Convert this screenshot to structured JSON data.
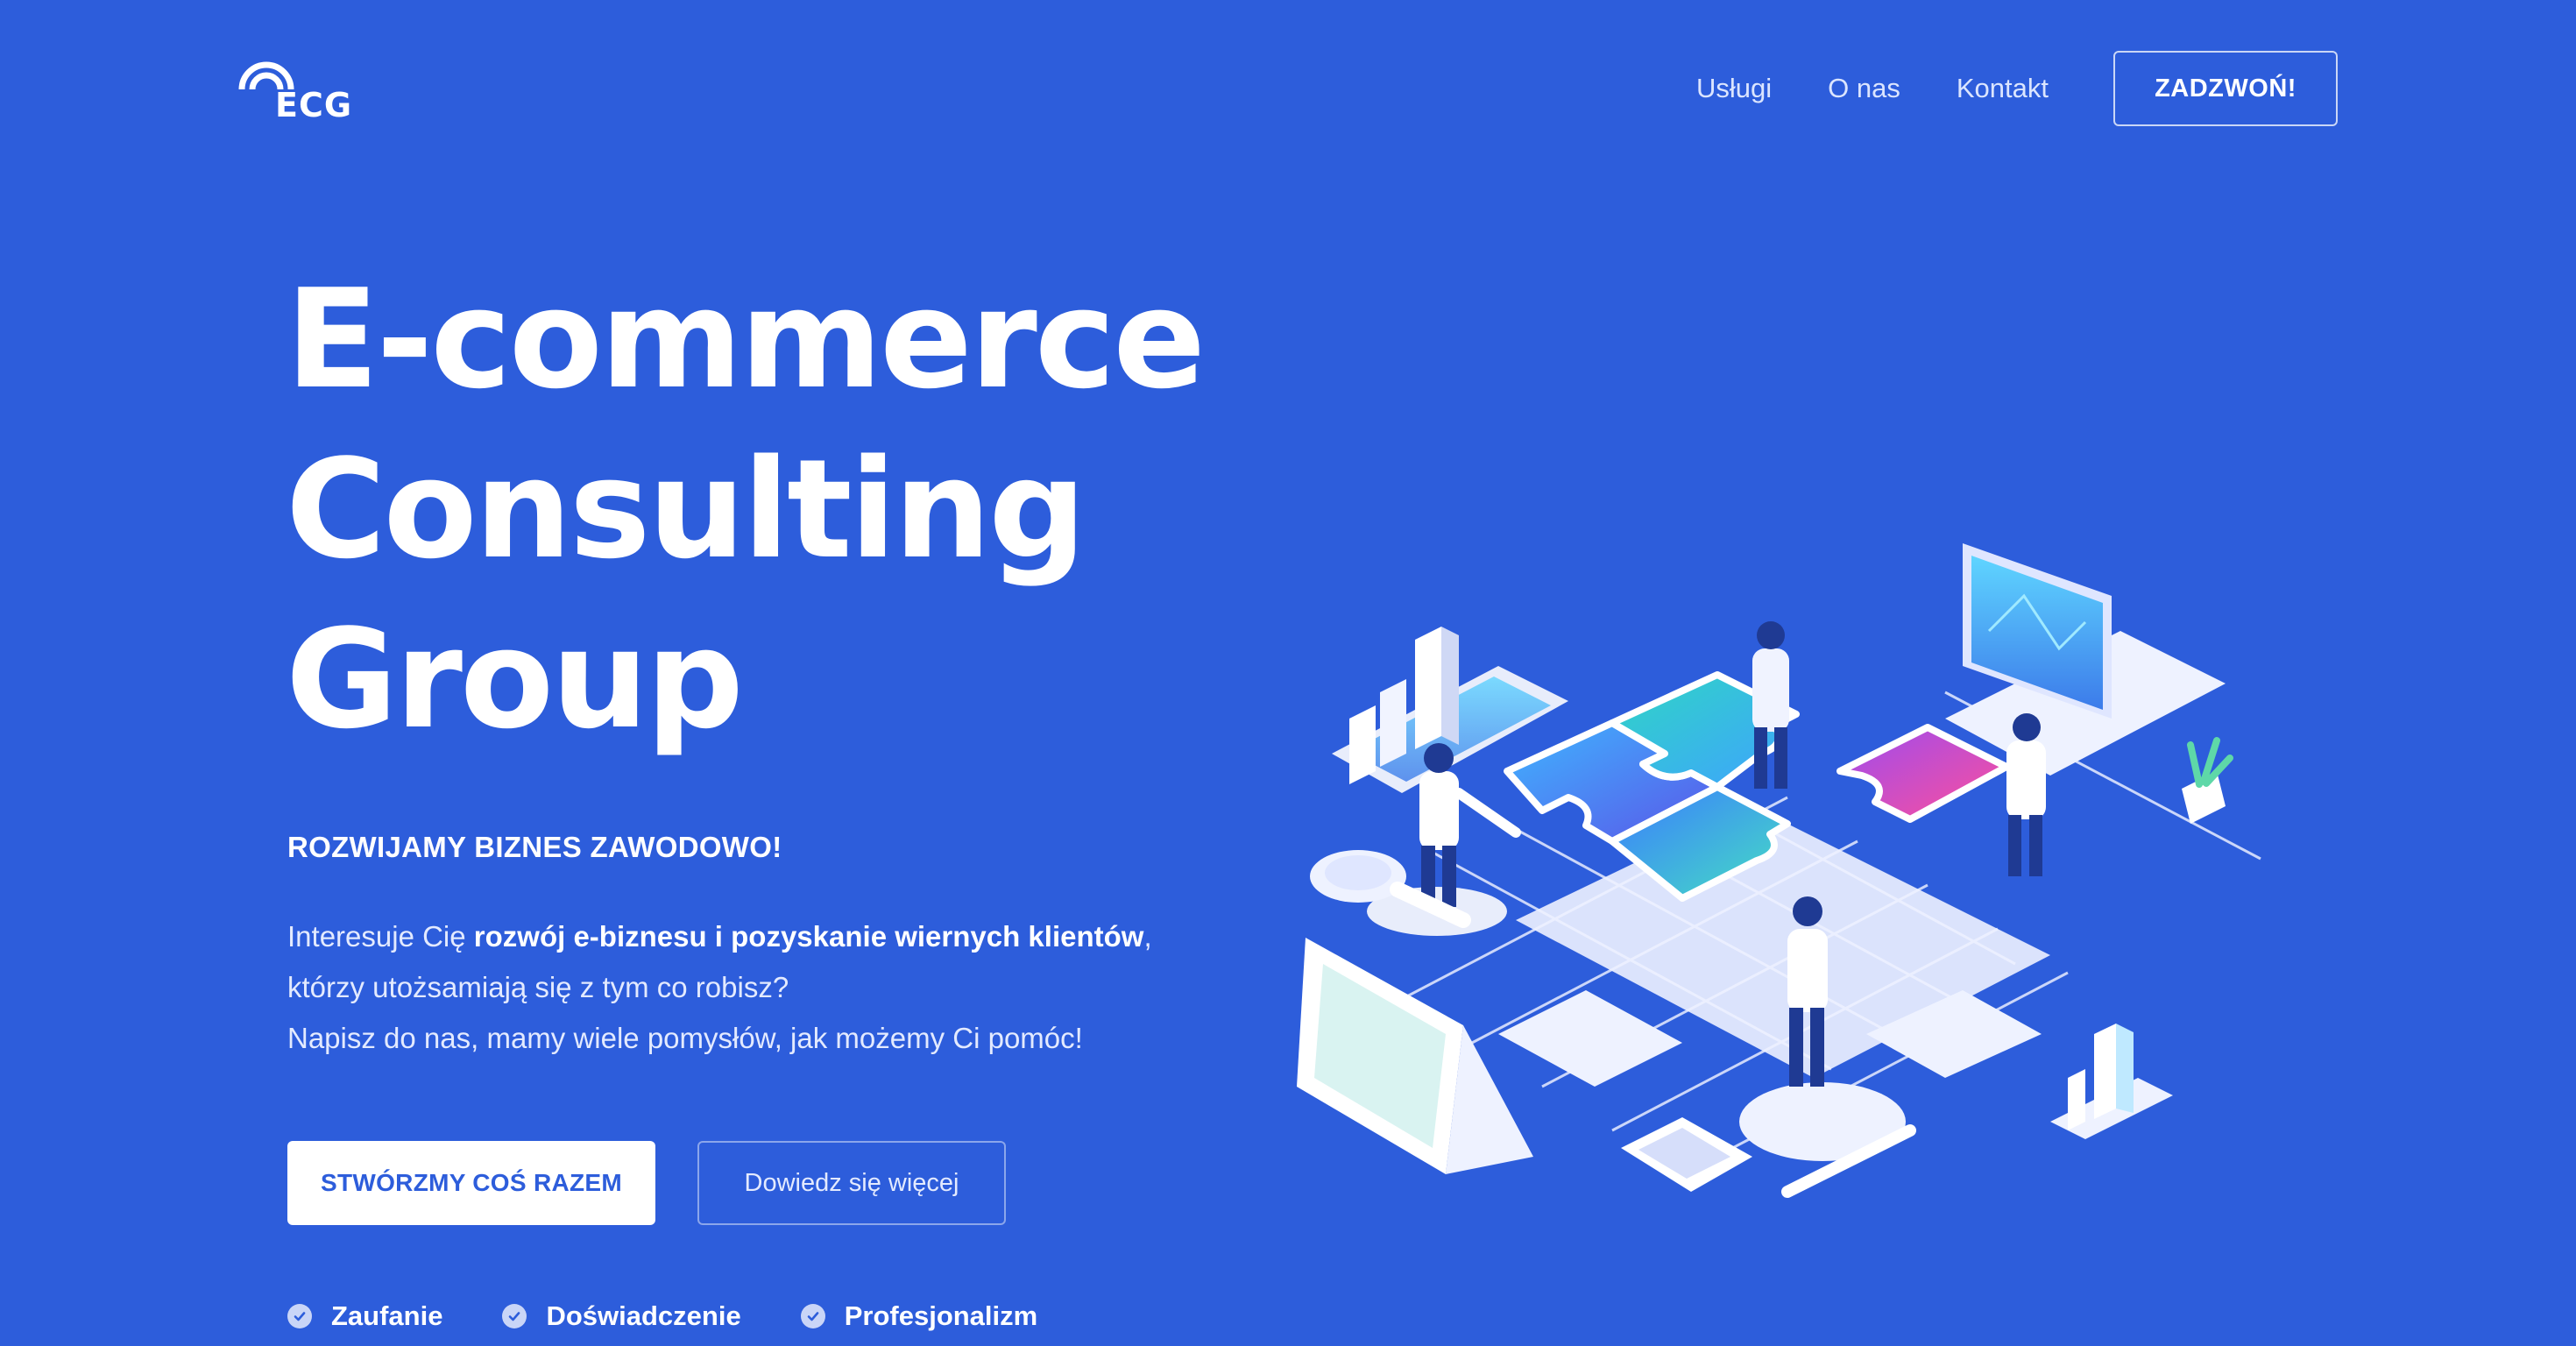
{
  "header": {
    "logo_text": "ECG",
    "nav": [
      "Usługi",
      "O nas",
      "Kontakt"
    ],
    "call_button": "ZADZWOŃ!"
  },
  "hero": {
    "title_lines": [
      "E-commerce",
      "Consulting",
      "Group"
    ],
    "tagline": "ROZWIJAMY BIZNES ZAWODOWO!",
    "intro": {
      "line1_pre": "Interesuje Cię ",
      "line1_bold": "rozwój e-biznesu i pozyskanie wiernych klientów",
      "line1_post": ",",
      "line2": "którzy utożsamiają się z tym co robisz?",
      "line3": "Napisz do nas, mamy wiele pomysłów, jak możemy Ci pomóc!"
    },
    "cta_primary": "STWÓRZMY COŚ RAZEM",
    "cta_secondary": "Dowiedz się więcej",
    "features": [
      "Zaufanie",
      "Doświadczenie",
      "Profesjonalizm"
    ]
  },
  "colors": {
    "background": "#2d5ddb",
    "text": "#ffffff",
    "cta_text": "#2d5ddb"
  },
  "icons": [
    "logo-arc-icon",
    "check-circle-icon",
    "isometric-teamwork-puzzle-illustration"
  ]
}
